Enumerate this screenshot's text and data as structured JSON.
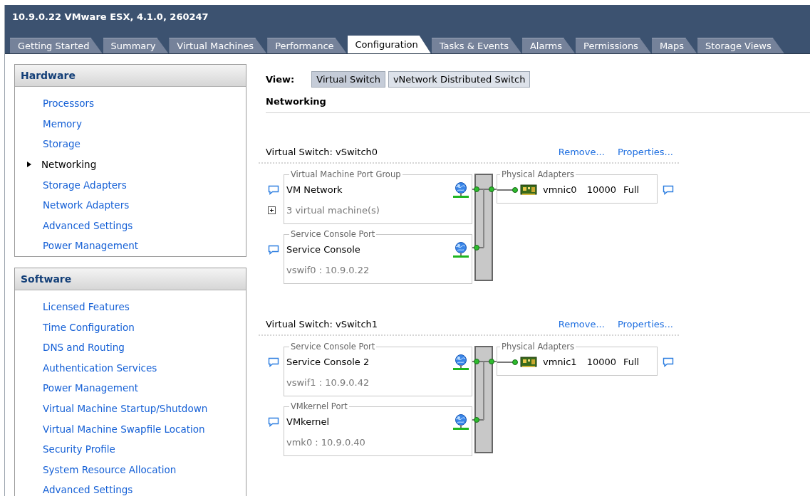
{
  "window": {
    "title": "10.9.0.22 VMware ESX, 4.1.0, 260247"
  },
  "tabs": [
    {
      "label": "Getting Started",
      "selected": false
    },
    {
      "label": "Summary",
      "selected": false
    },
    {
      "label": "Virtual Machines",
      "selected": false
    },
    {
      "label": "Performance",
      "selected": false
    },
    {
      "label": "Configuration",
      "selected": true
    },
    {
      "label": "Tasks & Events",
      "selected": false
    },
    {
      "label": "Alarms",
      "selected": false
    },
    {
      "label": "Permissions",
      "selected": false
    },
    {
      "label": "Maps",
      "selected": false
    },
    {
      "label": "Storage Views",
      "selected": false
    }
  ],
  "sidebar": {
    "sections": [
      {
        "title": "Hardware",
        "items": [
          {
            "label": "Processors",
            "selected": false
          },
          {
            "label": "Memory",
            "selected": false
          },
          {
            "label": "Storage",
            "selected": false
          },
          {
            "label": "Networking",
            "selected": true
          },
          {
            "label": "Storage Adapters",
            "selected": false
          },
          {
            "label": "Network Adapters",
            "selected": false
          },
          {
            "label": "Advanced Settings",
            "selected": false
          },
          {
            "label": "Power Management",
            "selected": false
          }
        ]
      },
      {
        "title": "Software",
        "items": [
          {
            "label": "Licensed Features",
            "selected": false
          },
          {
            "label": "Time Configuration",
            "selected": false
          },
          {
            "label": "DNS and Routing",
            "selected": false
          },
          {
            "label": "Authentication Services",
            "selected": false
          },
          {
            "label": "Power Management",
            "selected": false
          },
          {
            "label": "Virtual Machine Startup/Shutdown",
            "selected": false
          },
          {
            "label": "Virtual Machine Swapfile Location",
            "selected": false
          },
          {
            "label": "Security Profile",
            "selected": false
          },
          {
            "label": "System Resource Allocation",
            "selected": false
          },
          {
            "label": "Advanced Settings",
            "selected": false
          }
        ]
      }
    ]
  },
  "view": {
    "label": "View:",
    "options": [
      {
        "label": "Virtual Switch",
        "selected": true
      },
      {
        "label": "vNetwork Distributed Switch",
        "selected": false
      }
    ]
  },
  "section_title": "Networking",
  "switches": [
    {
      "title": "Virtual Switch: vSwitch0",
      "actions": [
        "Remove...",
        "Properties..."
      ],
      "port_groups": [
        {
          "group_label": "Virtual Machine Port Group",
          "name": "VM Network",
          "detail": "3 virtual machine(s)",
          "expandable": true
        },
        {
          "group_label": "Service Console Port",
          "name": "Service Console",
          "detail": "vswif0 : 10.9.0.22",
          "expandable": false
        }
      ],
      "adapters": {
        "label": "Physical Adapters",
        "items": [
          {
            "name": "vmnic0",
            "speed": "10000",
            "duplex": "Full"
          }
        ]
      }
    },
    {
      "title": "Virtual Switch: vSwitch1",
      "actions": [
        "Remove...",
        "Properties..."
      ],
      "port_groups": [
        {
          "group_label": "Service Console Port",
          "name": "Service Console 2",
          "detail": "vswif1 : 10.9.0.42",
          "expandable": false
        },
        {
          "group_label": "VMkernel Port",
          "name": "VMkernel",
          "detail": "vmk0 : 10.9.0.40",
          "expandable": false
        }
      ],
      "adapters": {
        "label": "Physical Adapters",
        "items": [
          {
            "name": "vmnic1",
            "speed": "10000",
            "duplex": "Full"
          }
        ]
      }
    }
  ]
}
